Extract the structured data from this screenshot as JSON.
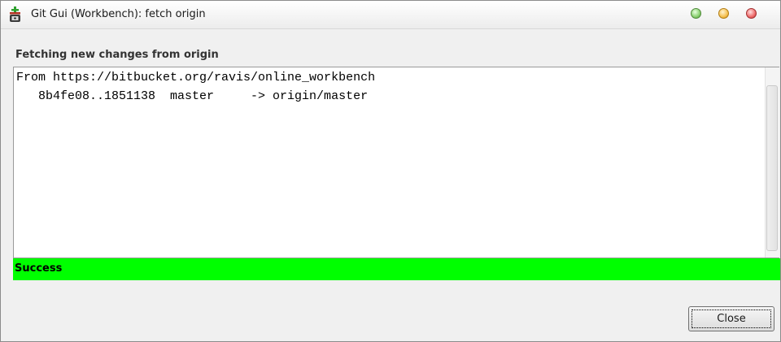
{
  "window": {
    "title": "Git Gui (Workbench): fetch origin",
    "icon": "git-gui-icon",
    "buttons": [
      "minimize",
      "maximize",
      "close"
    ],
    "colors": {
      "minimize": "#8ad070",
      "maximize": "#f5c050",
      "close": "#ee6b6b"
    }
  },
  "dialog": {
    "heading": "Fetching new changes from origin",
    "console_lines": [
      "From https://bitbucket.org/ravis/online_workbench",
      "   8b4fe08..1851138  master     -> origin/master"
    ],
    "status": "Success",
    "status_color": "#00ff00",
    "close_label": "Close"
  }
}
